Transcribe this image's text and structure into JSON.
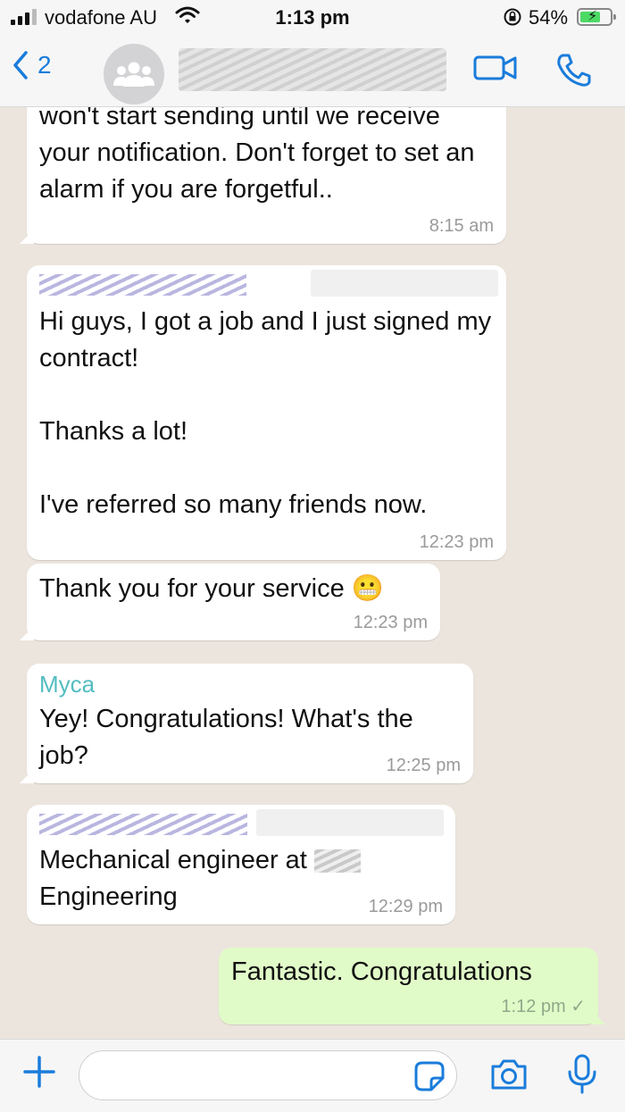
{
  "status_bar": {
    "carrier": "vodafone AU",
    "time": "1:13 pm",
    "battery_percent": "54%"
  },
  "header": {
    "back_count": "2",
    "icons": {
      "back": "chevron-left-icon",
      "avatar": "group-icon",
      "video": "video-call-icon",
      "call": "phone-icon"
    }
  },
  "messages": [
    {
      "direction": "incoming",
      "text": "won't start sending until we receive your notification. Don't forget to set an alarm if you are forgetful..",
      "time": "8:15 am"
    },
    {
      "direction": "incoming",
      "text": "Hi guys, I got a job and I just signed my contract!\n\nThanks a lot!\n\nI've referred so many friends now.",
      "time": "12:23 pm"
    },
    {
      "direction": "incoming",
      "text": "Thank you for your service 😬",
      "time": "12:23 pm"
    },
    {
      "direction": "incoming",
      "sender": "Myca",
      "text": "Yey! Congratulations! What's the job?",
      "time": "12:25 pm"
    },
    {
      "direction": "incoming",
      "text": "Mechanical engineer at ",
      "text2": "Engineering",
      "time": "12:29 pm"
    },
    {
      "direction": "outgoing",
      "text": "Fantastic. Congratulations",
      "time": "1:12 pm ✓",
      "status": "sent"
    }
  ],
  "input_bar": {
    "placeholder": "",
    "icons": {
      "attach": "plus-icon",
      "sticker": "sticker-icon",
      "camera": "camera-icon",
      "mic": "microphone-icon"
    }
  },
  "colors": {
    "accent": "#1a7cdb",
    "chat_bg": "#ece5dd",
    "incoming_bubble": "#ffffff",
    "outgoing_bubble": "#e1fbc8",
    "sender_name": "#53bdc1"
  }
}
